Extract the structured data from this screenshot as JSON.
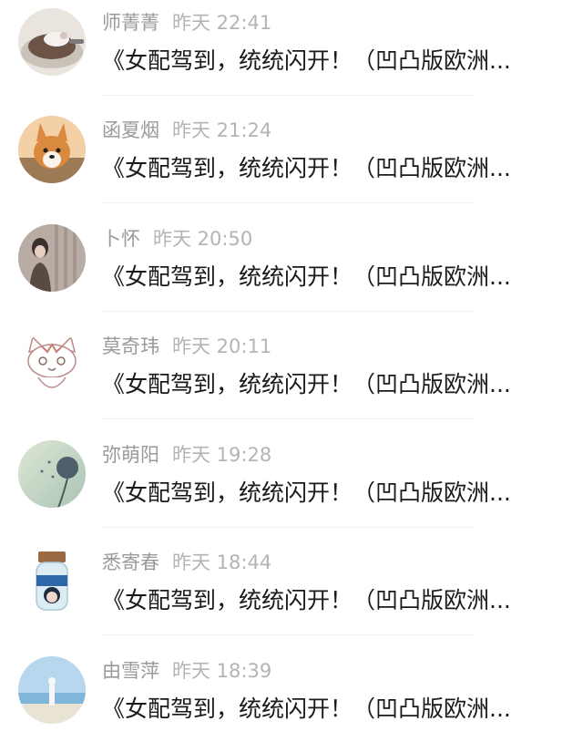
{
  "messages": [
    {
      "name": "师菁菁",
      "time": "昨天 22:41",
      "text": "《女配驾到，统统闪开！（凹凸版欧洲...",
      "avatar_icon": "cake-photo-avatar"
    },
    {
      "name": "函夏烟",
      "time": "昨天 21:24",
      "text": "《女配驾到，统统闪开！（凹凸版欧洲...",
      "avatar_icon": "corgi-photo-avatar"
    },
    {
      "name": "卜怀",
      "time": "昨天 20:50",
      "text": "《女配驾到，统统闪开！（凹凸版欧洲...",
      "avatar_icon": "girl-photo-avatar"
    },
    {
      "name": "莫奇玮",
      "time": "昨天 20:11",
      "text": "《女配驾到，统统闪开！（凹凸版欧洲...",
      "avatar_icon": "cartoon-cat-avatar"
    },
    {
      "name": "弥萌阳",
      "time": "昨天 19:28",
      "text": "《女配驾到，统统闪开！（凹凸版欧洲...",
      "avatar_icon": "dandelion-photo-avatar"
    },
    {
      "name": "悉寄春",
      "time": "昨天 18:44",
      "text": "《女配驾到，统统闪开！（凹凸版欧洲...",
      "avatar_icon": "jar-doll-avatar"
    },
    {
      "name": "由雪萍",
      "time": "昨天 18:39",
      "text": "《女配驾到，统统闪开！（凹凸版欧洲...",
      "avatar_icon": "beach-photo-avatar"
    }
  ]
}
